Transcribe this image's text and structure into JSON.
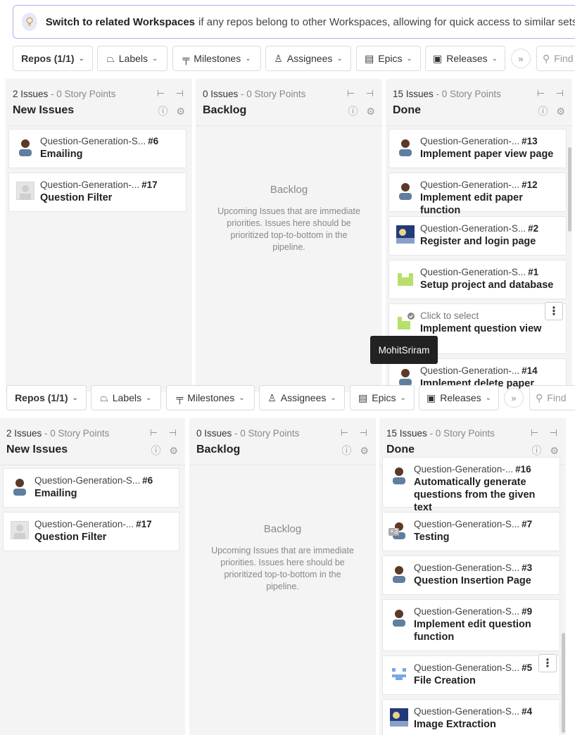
{
  "banner": {
    "bold": "Switch to related Workspaces",
    "rest": "if any repos belong to other Workspaces, allowing for quick access to similar sets of"
  },
  "toolbar": {
    "repos": "Repos (1/1)",
    "labels": "Labels",
    "milestones": "Milestones",
    "assignees": "Assignees",
    "epics": "Epics",
    "releases": "Releases",
    "more": "»",
    "find_placeholder": "Find"
  },
  "columns": {
    "new_issues": {
      "count": "2 Issues",
      "points": "- 0 Story Points",
      "title": "New Issues"
    },
    "backlog": {
      "count": "0 Issues",
      "points": "- 0 Story Points",
      "title": "Backlog",
      "placeholder_title": "Backlog",
      "placeholder_desc": "Upcoming Issues that are immediate priorities. Issues here should be prioritized top-to-bottom in the pipeline."
    },
    "done": {
      "count": "15 Issues",
      "points": "- 0 Story Points",
      "title": "Done"
    }
  },
  "top_board": {
    "new_issues": [
      {
        "repo": "Question-Generation-S...",
        "num": "#6",
        "title": "Emailing"
      },
      {
        "repo": "Question-Generation-...",
        "num": "#17",
        "title": "Question Filter"
      }
    ],
    "done": [
      {
        "repo": "Question-Generation-...",
        "num": "#13",
        "title": "Implement paper view page"
      },
      {
        "repo": "Question-Generation-...",
        "num": "#12",
        "title": "Implement edit paper function"
      },
      {
        "repo": "Question-Generation-S...",
        "num": "#2",
        "title": "Register and login page"
      },
      {
        "repo": "Question-Generation-S...",
        "num": "#1",
        "title": "Setup project and database"
      },
      {
        "repo": "Click to select",
        "num": "",
        "title": "Implement question view"
      },
      {
        "repo": "Question-Generation-...",
        "num": "#14",
        "title": "Implement delete paper"
      }
    ],
    "tooltip": "MohitSriram"
  },
  "bottom_board": {
    "new_issues": [
      {
        "repo": "Question-Generation-S...",
        "num": "#6",
        "title": "Emailing"
      },
      {
        "repo": "Question-Generation-...",
        "num": "#17",
        "title": "Question Filter"
      }
    ],
    "done": [
      {
        "repo": "Question-Generation-...",
        "num": "#16",
        "title": "Automatically generate questions from the given text"
      },
      {
        "repo": "Question-Generation-S...",
        "num": "#7",
        "title": "Testing",
        "badge": "+3"
      },
      {
        "repo": "Question-Generation-S...",
        "num": "#3",
        "title": "Question Insertion Page"
      },
      {
        "repo": "Question-Generation-S...",
        "num": "#9",
        "title": "Implement edit question function"
      },
      {
        "repo": "Question-Generation-S...",
        "num": "#5",
        "title": "File Creation"
      },
      {
        "repo": "Question-Generation-S...",
        "num": "#4",
        "title": "Image Extraction"
      }
    ]
  },
  "colors": {
    "banner_border": "#aeb3ee",
    "column_bg": "#f4f4f4",
    "tooltip_bg": "#222222"
  }
}
